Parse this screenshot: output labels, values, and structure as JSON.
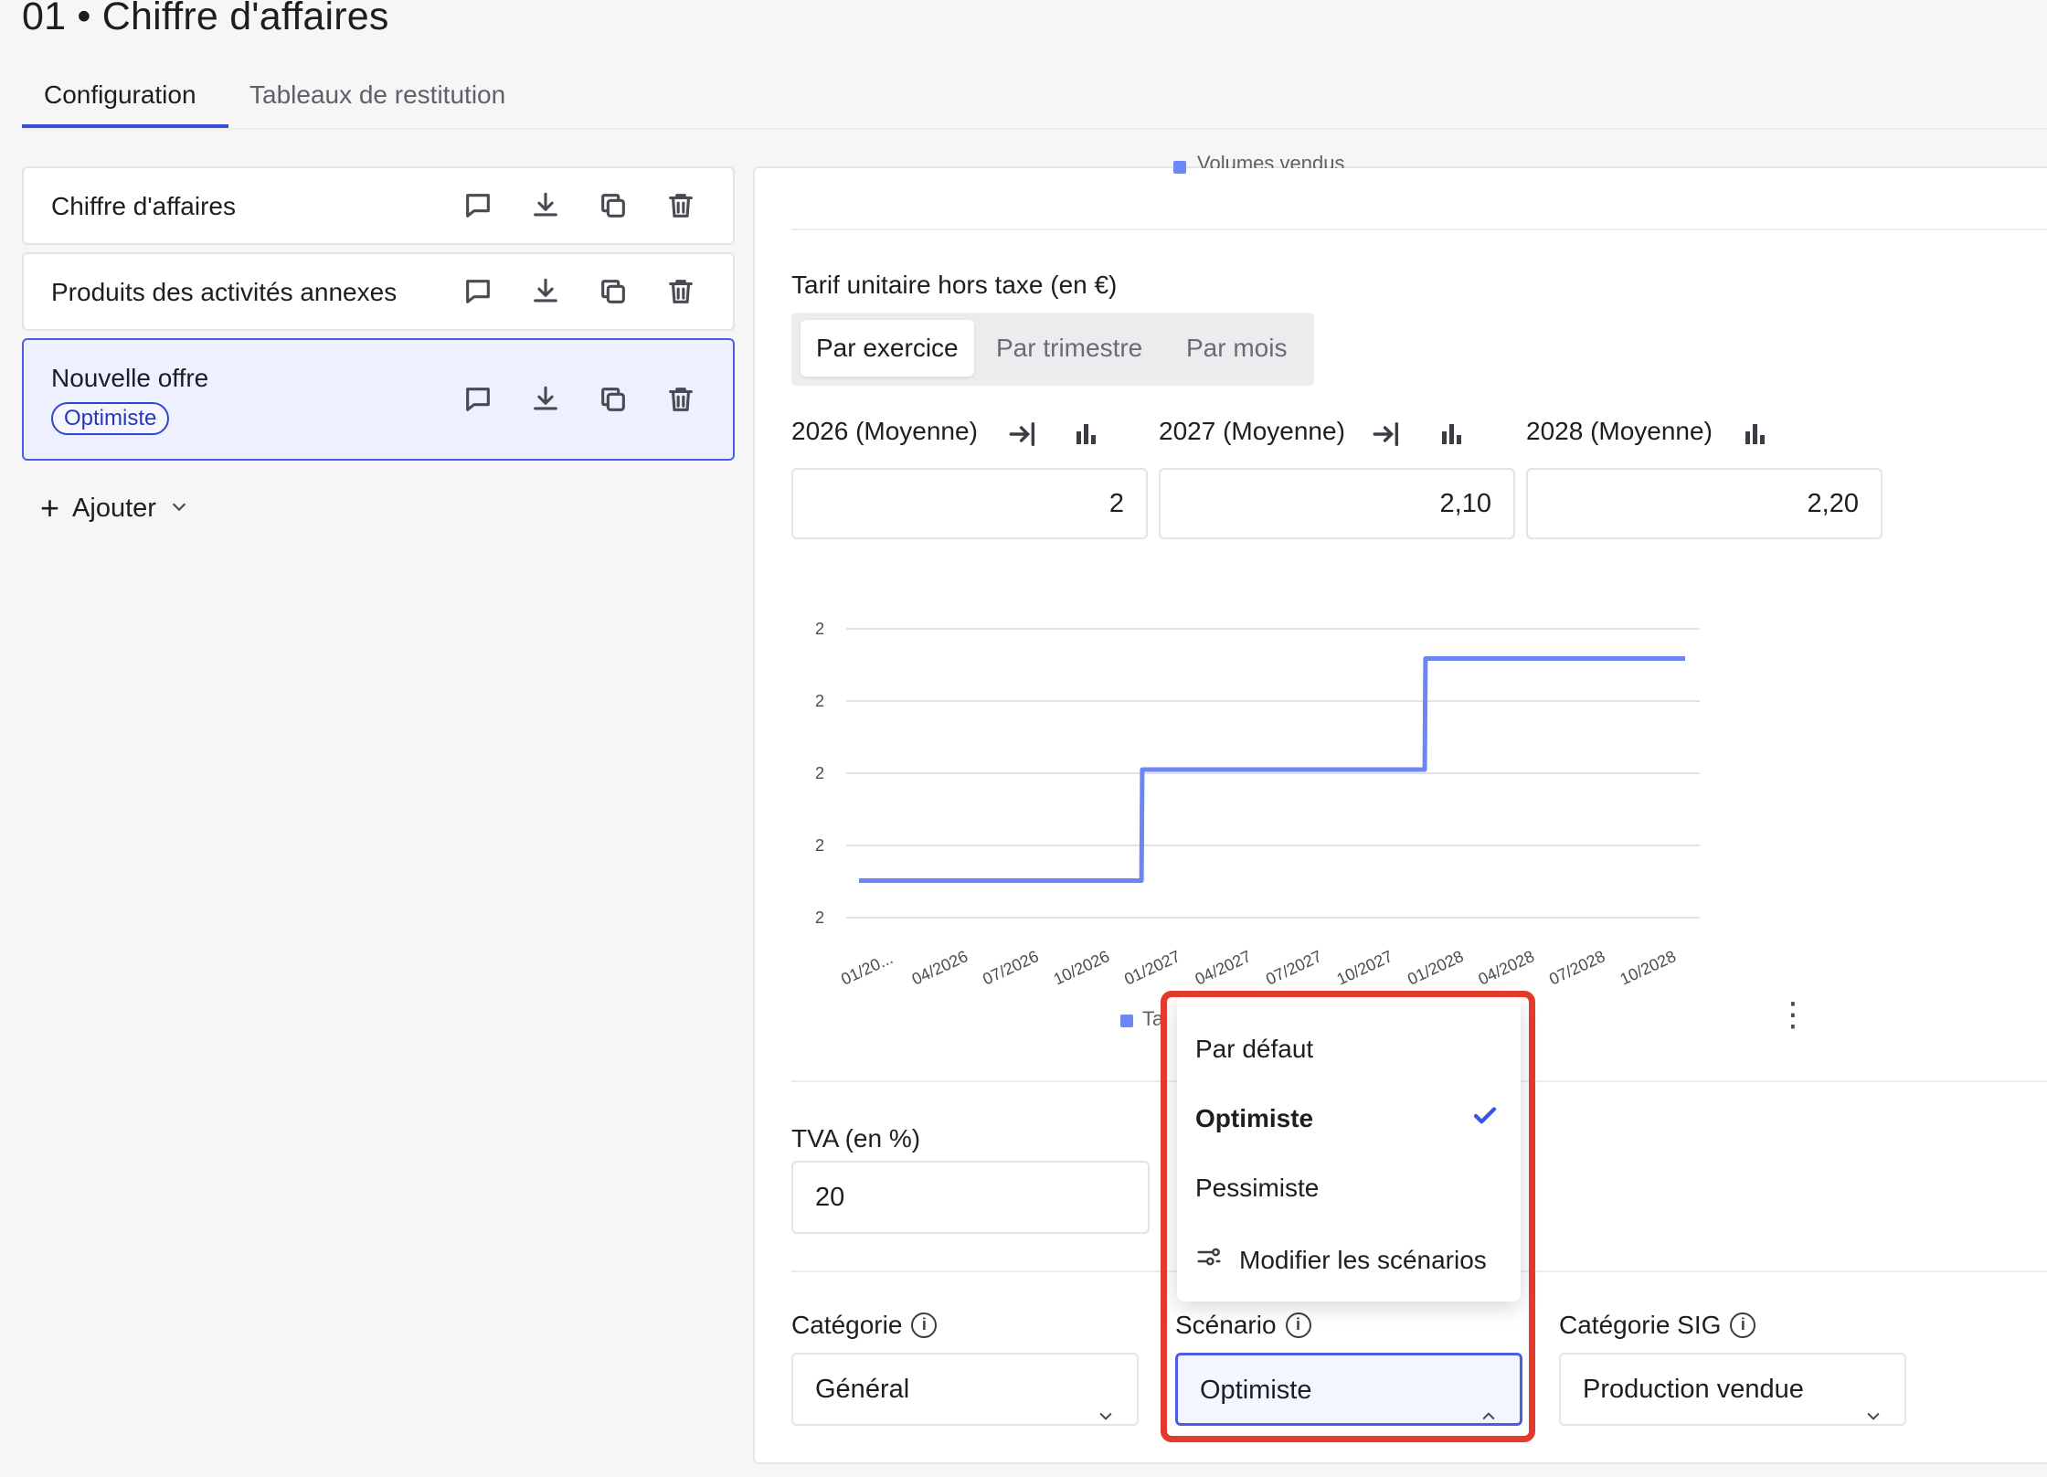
{
  "page": {
    "title": "01 • Chiffre d'affaires"
  },
  "tabs": [
    {
      "label": "Configuration",
      "active": true
    },
    {
      "label": "Tableaux de restitution",
      "active": false
    }
  ],
  "sidebar": {
    "items": [
      {
        "label": "Chiffre d'affaires",
        "badge": ""
      },
      {
        "label": "Produits des activités annexes",
        "badge": ""
      },
      {
        "label": "Nouvelle offre",
        "badge": "Optimiste",
        "selected": true
      }
    ],
    "add_label": "Ajouter"
  },
  "panel": {
    "top_legend": "Volumes vendus",
    "tarif": {
      "label": "Tarif unitaire hors taxe (en €)",
      "periods": [
        "Par exercice",
        "Par trimestre",
        "Par mois"
      ],
      "active_period": "Par exercice",
      "years": [
        {
          "label": "2026 (Moyenne)",
          "value": "2"
        },
        {
          "label": "2027 (Moyenne)",
          "value": "2,10"
        },
        {
          "label": "2028 (Moyenne)",
          "value": "2,20"
        }
      ]
    },
    "tva": {
      "label": "TVA (en %)",
      "value": "20"
    },
    "categorie": {
      "label": "Catégorie",
      "value": "Général"
    },
    "scenario": {
      "label": "Scénario",
      "value": "Optimiste"
    },
    "categorie_sig": {
      "label": "Catégorie SIG",
      "value": "Production vendue"
    }
  },
  "chart_data": {
    "type": "line",
    "x": [
      "01/2026",
      "02/2026",
      "03/2026",
      "04/2026",
      "05/2026",
      "06/2026",
      "07/2026",
      "08/2026",
      "09/2026",
      "10/2026",
      "11/2026",
      "12/2026",
      "01/2027",
      "02/2027",
      "03/2027",
      "04/2027",
      "05/2027",
      "06/2027",
      "07/2027",
      "08/2027",
      "09/2027",
      "10/2027",
      "11/2027",
      "12/2027",
      "01/2028",
      "02/2028",
      "03/2028",
      "04/2028",
      "05/2028",
      "06/2028",
      "07/2028",
      "08/2028",
      "09/2028",
      "10/2028",
      "11/2028",
      "12/2028"
    ],
    "tick_labels": [
      "01/20...",
      "04/2026",
      "07/2026",
      "10/2026",
      "01/2027",
      "04/2027",
      "07/2027",
      "10/2027",
      "01/2028",
      "04/2028",
      "07/2028",
      "10/2028"
    ],
    "series": [
      {
        "name": "Ta",
        "color": "#6b86f5",
        "values": [
          2,
          2,
          2,
          2,
          2,
          2,
          2,
          2,
          2,
          2,
          2,
          2,
          2.1,
          2.1,
          2.1,
          2.1,
          2.1,
          2.1,
          2.1,
          2.1,
          2.1,
          2.1,
          2.1,
          2.1,
          2.2,
          2.2,
          2.2,
          2.2,
          2.2,
          2.2,
          2.2,
          2.2,
          2.2,
          2.2,
          2.2,
          2.2
        ]
      }
    ],
    "y_tick_labels": [
      "2",
      "2",
      "2",
      "2",
      "2"
    ],
    "ylim": [
      1.97,
      2.23
    ],
    "grid": true
  },
  "dropdown": {
    "options": [
      {
        "label": "Par défaut",
        "selected": false
      },
      {
        "label": "Optimiste",
        "selected": true
      },
      {
        "label": "Pessimiste",
        "selected": false
      }
    ],
    "modify_label": "Modifier les scénarios"
  },
  "colors": {
    "accent": "#3b55e0",
    "highlight": "#e23b2b",
    "line": "#6b86f5"
  }
}
